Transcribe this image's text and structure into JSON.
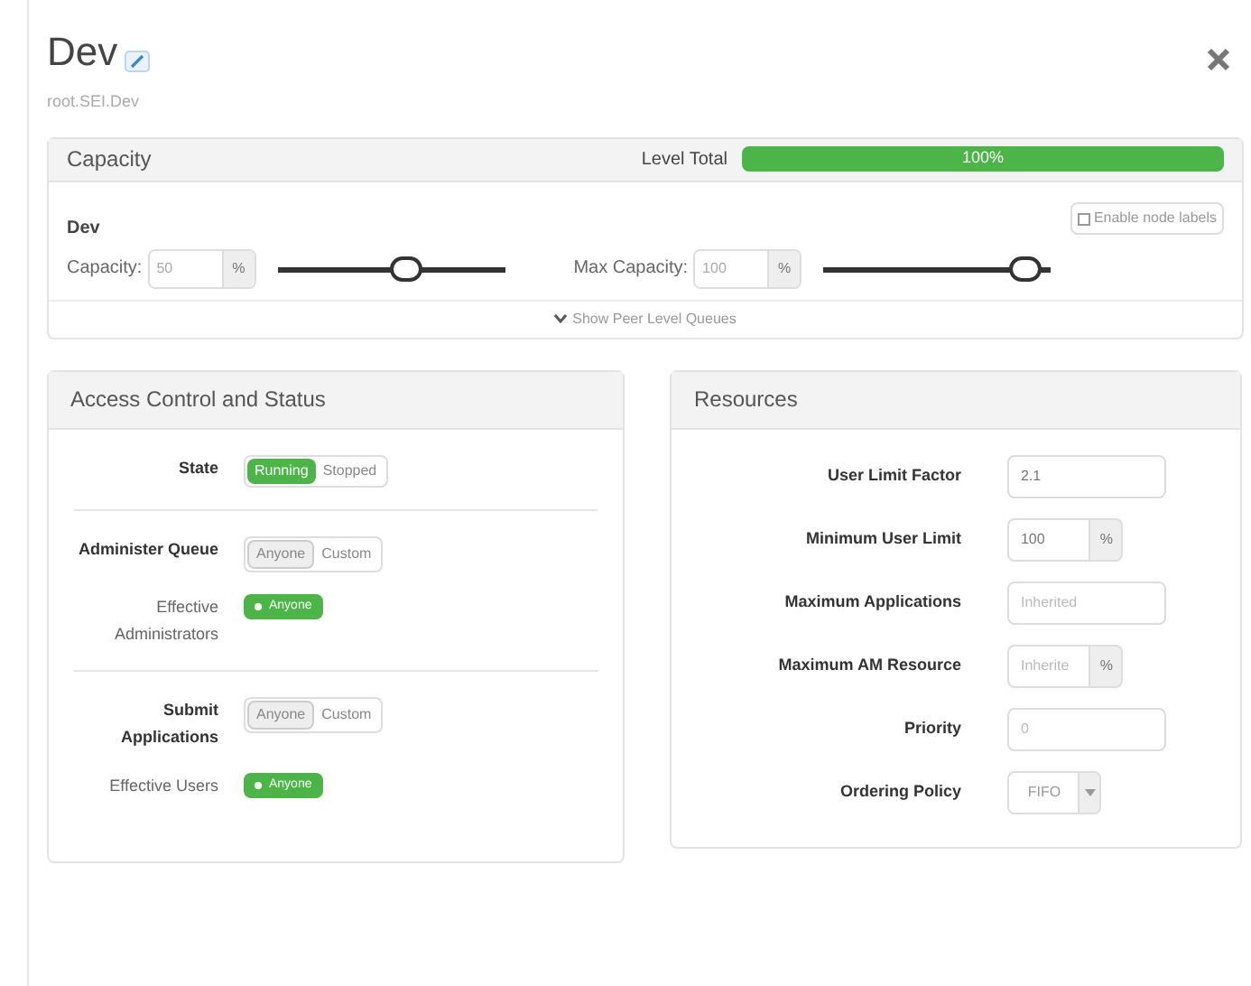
{
  "title": "Dev",
  "path": "root.SEI.Dev",
  "capacity": {
    "heading": "Capacity",
    "level_total_label": "Level Total",
    "level_total": {
      "text": "100%",
      "level": 1
    },
    "queue": "Dev",
    "node_labels": {
      "label": "Enable node labels",
      "checked": false
    },
    "sliders": [
      {
        "label": "Capacity:",
        "value": "50",
        "unit": "%",
        "level": 0.58
      },
      {
        "label": "Max Capacity:",
        "value": "100",
        "unit": "%",
        "level": 0.95
      }
    ],
    "peer_toggle": "Show Peer Level Queues"
  },
  "access": {
    "heading": "Access Control and Status",
    "rows": [
      {
        "kind": "toggle",
        "label": "State",
        "options": [
          {
            "label": "Running",
            "selected": true
          },
          {
            "label": "Stopped",
            "selected": false
          }
        ],
        "divider": true
      },
      {
        "kind": "toggle",
        "label": "Administer Queue",
        "options": [
          {
            "label": "Anyone",
            "selected": true
          },
          {
            "label": "Custom",
            "selected": false
          }
        ]
      },
      {
        "kind": "badge",
        "label": "Effective Administrators",
        "badge": "Anyone",
        "divider": true
      },
      {
        "kind": "toggle",
        "label": "Submit Applications",
        "options": [
          {
            "label": "Anyone",
            "selected": true
          },
          {
            "label": "Custom",
            "selected": false
          }
        ]
      },
      {
        "kind": "badge",
        "label": "Effective Users",
        "badge": "Anyone"
      }
    ]
  },
  "resources": {
    "heading": "Resources",
    "rows": [
      {
        "kind": "text",
        "label": "User Limit Factor",
        "value": "2.1"
      },
      {
        "kind": "percent",
        "label": "Minimum User Limit",
        "value": "100",
        "unit": "%"
      },
      {
        "kind": "text",
        "label": "Maximum Applications",
        "placeholder": "Inherited"
      },
      {
        "kind": "percent",
        "label": "Maximum AM Resource",
        "placeholder": "Inherite",
        "unit": "%"
      },
      {
        "kind": "text",
        "label": "Priority",
        "placeholder": "0"
      },
      {
        "kind": "select",
        "label": "Ordering Policy",
        "value": "FIFO"
      }
    ]
  }
}
